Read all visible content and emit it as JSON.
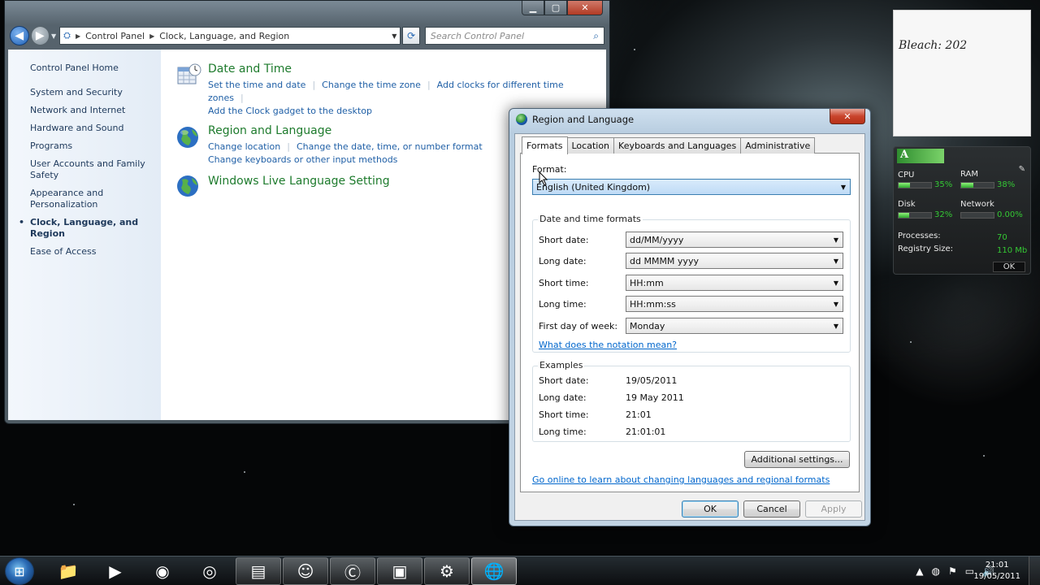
{
  "control_panel": {
    "address": {
      "root": "Control Panel",
      "current": "Clock, Language, and Region"
    },
    "search_placeholder": "Search Control Panel",
    "sidebar": {
      "home": "Control Panel Home",
      "items": [
        "System and Security",
        "Network and Internet",
        "Hardware and Sound",
        "Programs",
        "User Accounts and Family Safety",
        "Appearance and Personalization",
        "Clock, Language, and Region",
        "Ease of Access"
      ]
    },
    "categories": {
      "date_time": {
        "title": "Date and Time",
        "links": [
          "Set the time and date",
          "Change the time zone",
          "Add clocks for different time zones",
          "Add the Clock gadget to the desktop"
        ]
      },
      "region": {
        "title": "Region and Language",
        "links": [
          "Change location",
          "Change the date, time, or number format",
          "Change keyboards or other input methods"
        ]
      },
      "live": {
        "title": "Windows Live Language Setting"
      }
    }
  },
  "dialog": {
    "title": "Region and Language",
    "tabs": [
      "Formats",
      "Location",
      "Keyboards and Languages",
      "Administrative"
    ],
    "format_label": "Format:",
    "format_value": "English (United Kingdom)",
    "dt_group": "Date and time formats",
    "fields": {
      "short_date": {
        "label": "Short date:",
        "value": "dd/MM/yyyy"
      },
      "long_date": {
        "label": "Long date:",
        "value": "dd MMMM yyyy"
      },
      "short_time": {
        "label": "Short time:",
        "value": "HH:mm"
      },
      "long_time": {
        "label": "Long time:",
        "value": "HH:mm:ss"
      },
      "first_day": {
        "label": "First day of week:",
        "value": "Monday"
      }
    },
    "notation_link": "What does the notation mean?",
    "examples": {
      "title": "Examples",
      "short_date": {
        "label": "Short date:",
        "value": "19/05/2011"
      },
      "long_date": {
        "label": "Long date:",
        "value": "19 May 2011"
      },
      "short_time": {
        "label": "Short time:",
        "value": "21:01"
      },
      "long_time": {
        "label": "Long time:",
        "value": "21:01:01"
      }
    },
    "additional_btn": "Additional settings...",
    "online_link": "Go online to learn about changing languages and regional formats",
    "ok": "OK",
    "cancel": "Cancel",
    "apply": "Apply"
  },
  "gadgets": {
    "note_text": "Bleach: 202",
    "meter": {
      "header": "A",
      "cpu": {
        "label": "CPU",
        "pct": "35%",
        "level": 0.35
      },
      "ram": {
        "label": "RAM",
        "pct": "38%",
        "level": 0.38
      },
      "disk": {
        "label": "Disk",
        "pct": "32%",
        "level": 0.32
      },
      "network": {
        "label": "Network",
        "pct": "0.00%",
        "level": 0
      },
      "processes_label": "Processes:",
      "processes_value": "70",
      "registry_label": "Registry Size:",
      "registry_value": "110 Mb",
      "ok": "OK"
    }
  },
  "taskbar": {
    "time": "21:01",
    "date": "19/05/2011",
    "apps": [
      "explorer-icon",
      "media-player-icon",
      "chrome-icon",
      "firefox-icon",
      "folder-icon",
      "messenger-icon",
      "ccleaner-icon",
      "gpu-icon",
      "control-panel-icon",
      "region-globe-icon"
    ]
  }
}
